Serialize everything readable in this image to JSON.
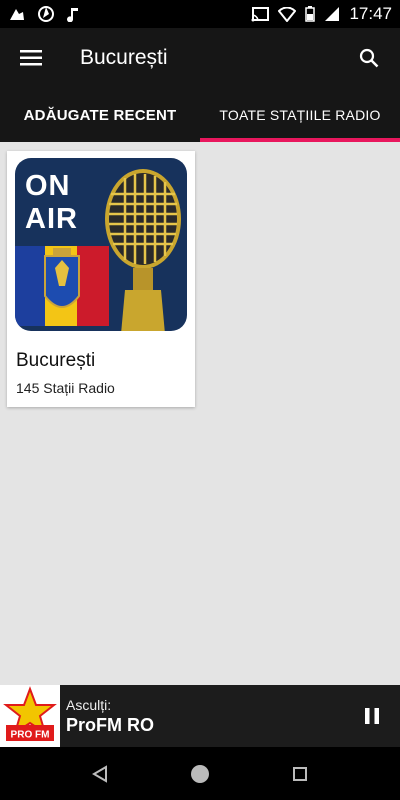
{
  "status_bar": {
    "time": "17:47",
    "icons": [
      "weather-icon",
      "aperture-icon",
      "music-note-icon",
      "cast-icon",
      "wifi-icon",
      "battery-icon",
      "signal-icon"
    ]
  },
  "app_bar": {
    "title": "București",
    "menu_icon": "hamburger-menu-icon",
    "search_icon": "search-icon"
  },
  "tabs": [
    {
      "label": "ADĂUGATE RECENT",
      "active": false
    },
    {
      "label": "TOATE STAȚIILE RADIO",
      "active": true
    }
  ],
  "cards": [
    {
      "image_text_line1": "ON",
      "image_text_line2": "AIR",
      "title": "București",
      "subtitle": "145 Stații Radio"
    }
  ],
  "player": {
    "label": "Asculți:",
    "station": "ProFM RO",
    "logo_text": "PRO FM",
    "state": "playing"
  },
  "colors": {
    "tab_indicator": "#e8175d",
    "app_bar": "#161616",
    "background": "#e4e4e4"
  }
}
